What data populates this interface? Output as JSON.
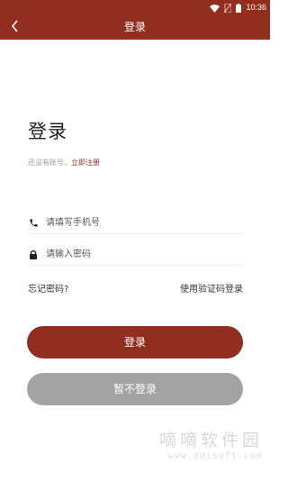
{
  "status_bar": {
    "time": "10:36",
    "icons": [
      "wifi-icon",
      "no-sim-icon",
      "battery-icon"
    ]
  },
  "app_bar": {
    "title": "登录",
    "back_icon": "chevron-left-icon"
  },
  "colors": {
    "brand": "#922e1f",
    "secondary_button": "#a3a3a3",
    "muted_text": "#9b9b9b"
  },
  "login": {
    "heading": "登录",
    "register_prompt": "还没有账号，",
    "register_link": "立即注册",
    "phone_field": {
      "icon": "phone-icon",
      "value": "",
      "placeholder": "请填写手机号"
    },
    "password_field": {
      "icon": "lock-icon",
      "value": "",
      "placeholder": "请输入密码"
    },
    "forgot_password": "忘记密码?",
    "code_login": "使用验证码登录",
    "login_button": "登录",
    "skip_button": "暂不登录"
  },
  "watermark": {
    "name": "嘀嘀软件园",
    "url": "www.ddisoft.com"
  }
}
